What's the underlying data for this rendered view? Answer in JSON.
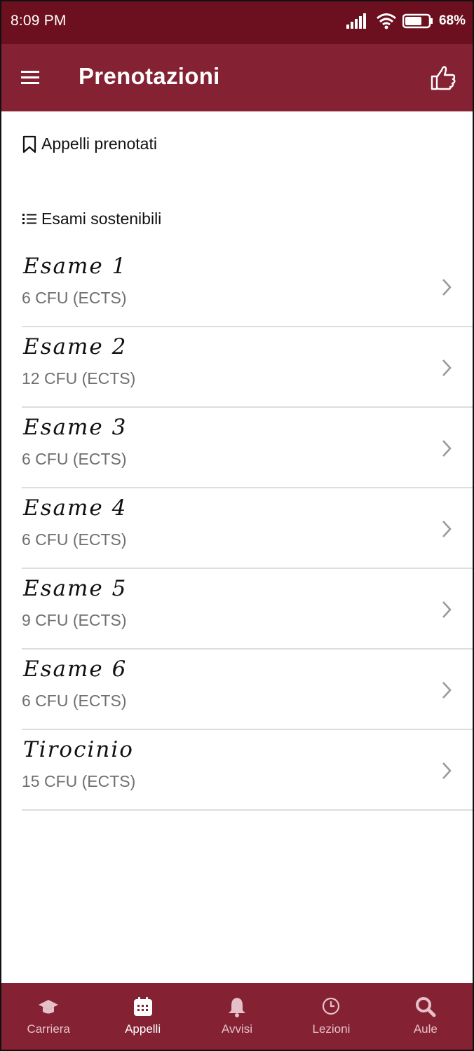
{
  "status": {
    "time": "8:09 PM",
    "battery": "68%"
  },
  "appbar": {
    "title": "Prenotazioni"
  },
  "sections": {
    "booked": "Appelli prenotati",
    "exams": "Esami sostenibili"
  },
  "exams": [
    {
      "name": "Esame 1",
      "cfu": "6 CFU (ECTS)"
    },
    {
      "name": "Esame 2",
      "cfu": "12 CFU (ECTS)"
    },
    {
      "name": "Esame 3",
      "cfu": "6 CFU (ECTS)"
    },
    {
      "name": "Esame 4",
      "cfu": "6 CFU (ECTS)"
    },
    {
      "name": "Esame 5",
      "cfu": "9 CFU (ECTS)"
    },
    {
      "name": "Esame 6",
      "cfu": "6 CFU (ECTS)"
    },
    {
      "name": "Tirocinio",
      "cfu": "15 CFU (ECTS)"
    }
  ],
  "nav": [
    {
      "label": "Carriera",
      "icon": "graduation-cap-icon"
    },
    {
      "label": "Appelli",
      "icon": "calendar-icon"
    },
    {
      "label": "Avvisi",
      "icon": "bell-icon"
    },
    {
      "label": "Lezioni",
      "icon": "clock-icon"
    },
    {
      "label": "Aule",
      "icon": "search-icon"
    }
  ],
  "colors": {
    "status_bar": "#6c0f1f",
    "app_bar": "#842233",
    "nav_inactive": "#e6c0c8",
    "divider": "#dddddd"
  }
}
